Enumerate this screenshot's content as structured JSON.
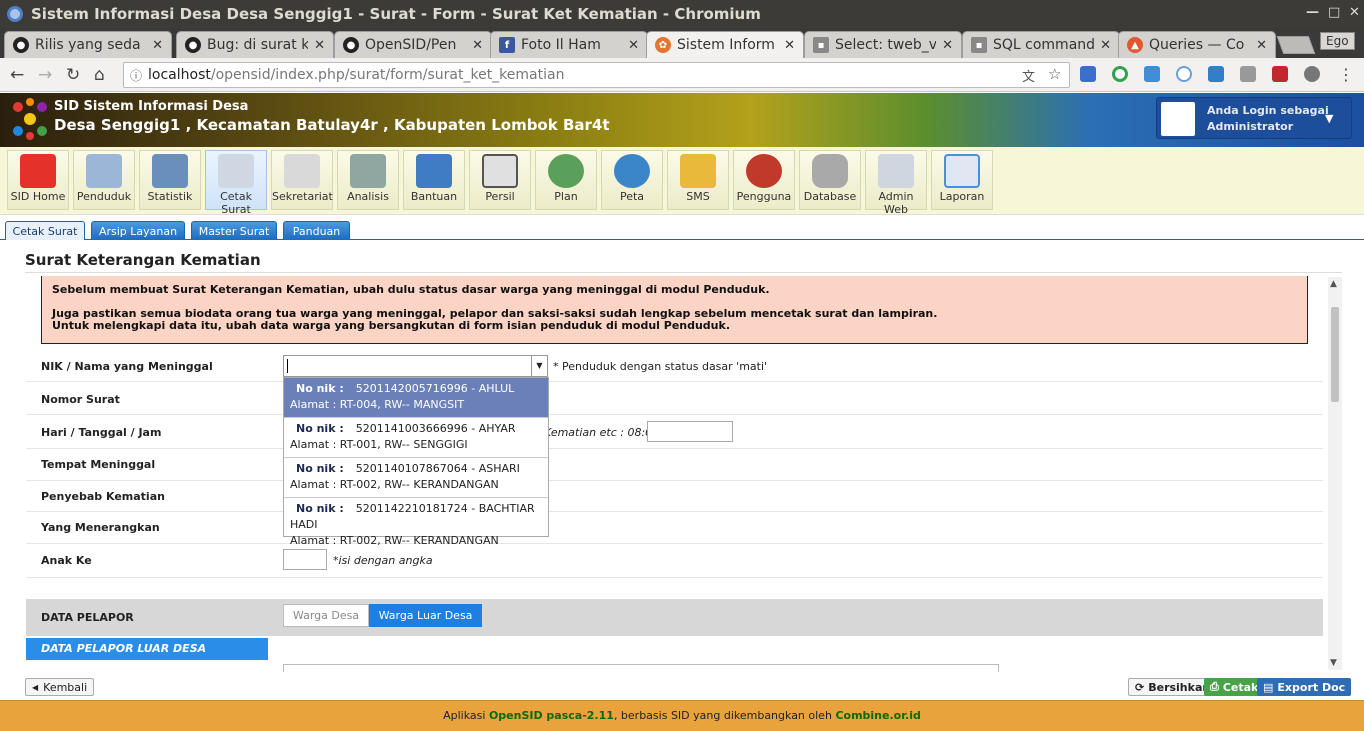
{
  "window": {
    "title": "Sistem Informasi Desa Desa Senggig1 - Surat - Form - Surat Ket Kematian - Chromium"
  },
  "tabs": [
    {
      "label": "Rilis yang seda",
      "icon": "github-icon"
    },
    {
      "label": "Bug: di surat k",
      "icon": "github-icon"
    },
    {
      "label": "OpenSID/Pen",
      "icon": "github-icon"
    },
    {
      "label": "Foto Il Ham",
      "icon": "facebook-icon"
    },
    {
      "label": "Sistem Inform",
      "icon": "sid-icon"
    },
    {
      "label": "Select: tweb_v",
      "icon": "db-icon"
    },
    {
      "label": "SQL command",
      "icon": "db-icon"
    },
    {
      "label": "Queries — Co",
      "icon": "fire-icon"
    }
  ],
  "ego_label": "Ego",
  "url": {
    "host": "localhost",
    "path": "/opensid/index.php/surat/form/surat_ket_kematian"
  },
  "header": {
    "app_name": "SID Sistem Informasi Desa",
    "village": "Desa Senggig1 , Kecamatan Batulay4r , Kabupaten Lombok Bar4t",
    "login_line1": "Anda Login sebagai",
    "login_line2": "Administrator"
  },
  "menu": [
    {
      "label": "SID Home"
    },
    {
      "label": "Penduduk"
    },
    {
      "label": "Statistik"
    },
    {
      "label": "Cetak Surat"
    },
    {
      "label": "Sekretariat"
    },
    {
      "label": "Analisis"
    },
    {
      "label": "Bantuan"
    },
    {
      "label": "Persil"
    },
    {
      "label": "Plan"
    },
    {
      "label": "Peta"
    },
    {
      "label": "SMS"
    },
    {
      "label": "Pengguna"
    },
    {
      "label": "Database"
    },
    {
      "label": "Admin Web"
    },
    {
      "label": "Laporan"
    }
  ],
  "subtabs": [
    {
      "label": "Cetak Surat"
    },
    {
      "label": "Arsip Layanan"
    },
    {
      "label": "Master Surat"
    },
    {
      "label": "Panduan"
    }
  ],
  "page_title": "Surat Keterangan Kematian",
  "warning": {
    "line1": "Sebelum membuat Surat Keterangan Kematian, ubah dulu status dasar warga yang meninggal di modul Penduduk.",
    "line2": "Juga pastikan semua biodata orang tua warga yang meninggal, pelapor dan saksi-saksi sudah lengkap sebelum mencetak surat dan lampiran.",
    "line3": "Untuk melengkapi data itu, ubah data warga yang bersangkutan di form isian penduduk di modul Penduduk."
  },
  "form": {
    "nik_label": "NIK / Nama yang Meninggal",
    "nik_hint": "* Penduduk dengan status dasar 'mati'",
    "nomor_label": "Nomor Surat",
    "hari_label": "Hari / Tanggal / Jam",
    "hari_hint": "Kematian etc : 08:00",
    "tempat_label": "Tempat Meninggal",
    "penyebab_label": "Penyebab Kematian",
    "menerangkan_label": "Yang Menerangkan",
    "anak_label": "Anak Ke",
    "anak_hint": "*isi dengan angka"
  },
  "dropdown": {
    "nik_prefix": "No nik :",
    "items": [
      {
        "nik": "5201142005716996 - AHLUL",
        "alamat": "Alamat : RT-004, RW-- MANGSIT"
      },
      {
        "nik": "5201141003666996 - AHYAR",
        "alamat": "Alamat : RT-001, RW-- SENGGIGI"
      },
      {
        "nik": "5201140107867064 - ASHARI",
        "alamat": "Alamat : RT-002, RW-- KERANDANGAN"
      },
      {
        "nik": "5201142210181724 - BACHTIAR HADI",
        "alamat": "Alamat : RT-002, RW-- KERANDANGAN"
      }
    ]
  },
  "pelapor": {
    "label": "DATA PELAPOR",
    "warga_desa": "Warga Desa",
    "warga_luar": "Warga Luar Desa",
    "luar_header": "DATA PELAPOR LUAR DESA"
  },
  "buttons": {
    "kembali": "Kembali",
    "bersihkan": "Bersihkan",
    "cetak": "Cetak",
    "export": "Export Doc"
  },
  "footer": {
    "pre": "Aplikasi",
    "app": "OpenSID pasca-2.11",
    "mid": ", berbasis SID yang dikembangkan oleh",
    "by": "Combine.or.id"
  }
}
